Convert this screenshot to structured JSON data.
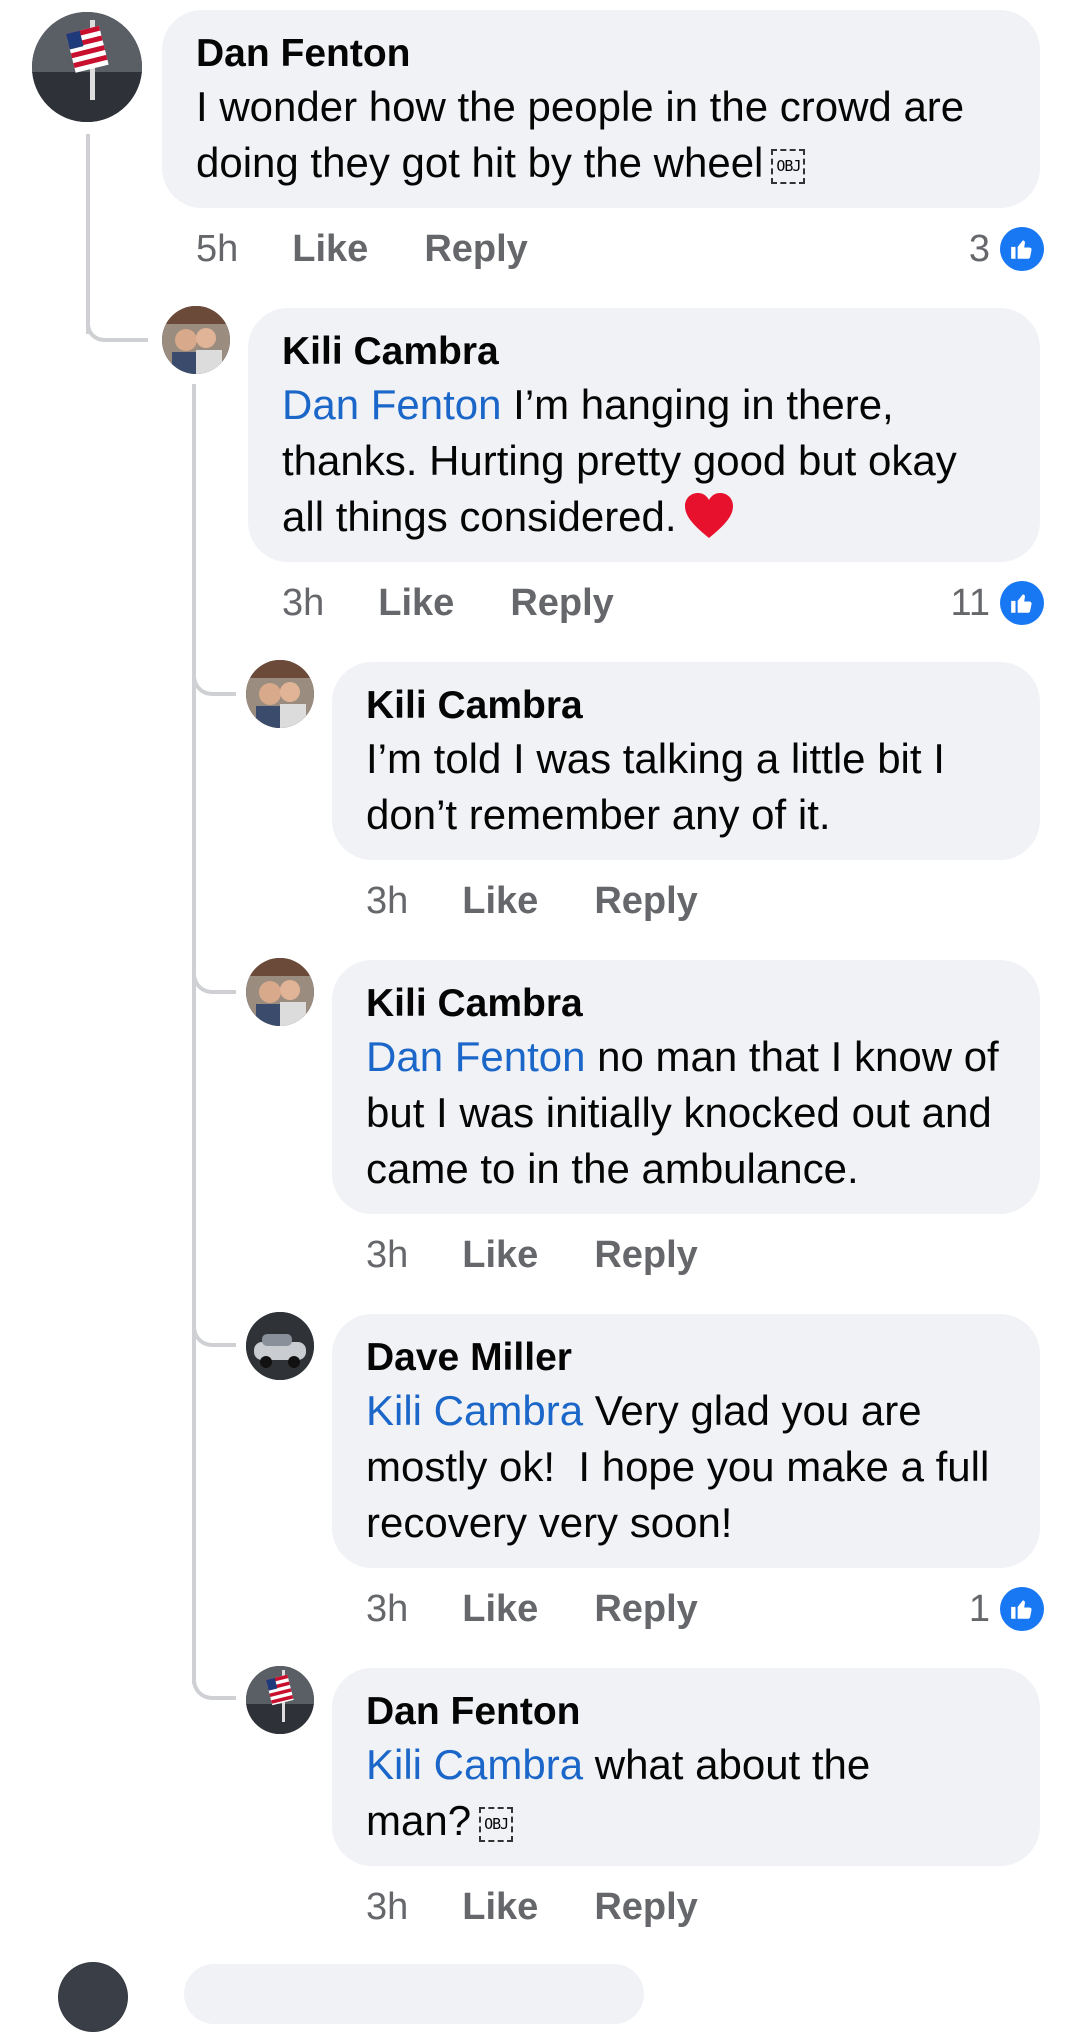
{
  "comments": [
    {
      "author": "Dan Fenton",
      "mention": "",
      "text": "I wonder how the people in the crowd are doing they got hit by the wheel",
      "obj": "OBJ",
      "time": "5h",
      "like": "Like",
      "reply": "Reply",
      "reactions": "3"
    },
    {
      "author": "Kili Cambra",
      "mention": "Dan Fenton",
      "text": " I’m hanging in there, thanks. Hurting pretty good but okay all things considered.",
      "time": "3h",
      "like": "Like",
      "reply": "Reply",
      "reactions": "11"
    },
    {
      "author": "Kili Cambra",
      "mention": "",
      "text": "I’m told I was talking a little bit I don’t remember any of it.",
      "time": "3h",
      "like": "Like",
      "reply": "Reply"
    },
    {
      "author": "Kili Cambra",
      "mention": "Dan Fenton",
      "text": " no man that I know of but I was initially knocked out and came to in the ambulance.",
      "time": "3h",
      "like": "Like",
      "reply": "Reply"
    },
    {
      "author": "Dave Miller",
      "mention": "Kili Cambra",
      "text": " Very glad you are mostly ok!  I hope you make a full recovery very soon!",
      "time": "3h",
      "like": "Like",
      "reply": "Reply",
      "reactions": "1"
    },
    {
      "author": "Dan Fenton",
      "mention": "Kili Cambra",
      "text": " what about the man?",
      "obj": "OBJ",
      "time": "3h",
      "like": "Like",
      "reply": "Reply"
    }
  ],
  "icons": {
    "like": "like-thumb-icon",
    "heart": "red-heart-emoji",
    "object": "object-replacement-glyph"
  },
  "colors": {
    "bubble": "#f0f2f5",
    "mention": "#1b66c9",
    "like_badge": "#1877f2",
    "meta_text": "#65676b"
  }
}
